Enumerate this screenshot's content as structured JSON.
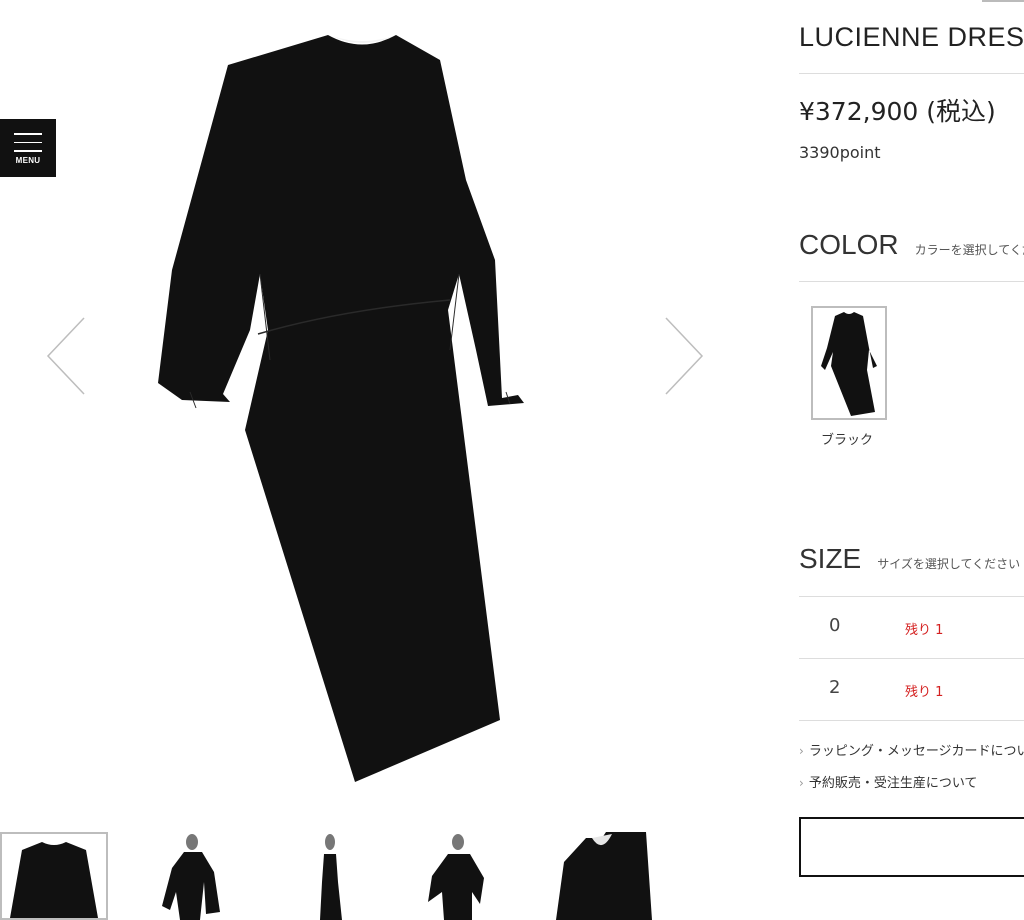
{
  "menu": {
    "label": "MENU",
    "icon": "hamburger-icon"
  },
  "gallery": {
    "prev_icon": "chevron-left-icon",
    "next_icon": "chevron-right-icon",
    "thumbnails_count": 5,
    "selected_thumbnail": 1
  },
  "product": {
    "name": "LUCIENNE DRESS",
    "price": "¥372,900 (税込)",
    "points": "3390point"
  },
  "color": {
    "heading": "COLOR",
    "hint": "カラーを選択してください",
    "options": [
      {
        "label": "ブラック"
      }
    ]
  },
  "size": {
    "heading": "SIZE",
    "hint": "サイズを選択してください",
    "rows": [
      {
        "size": "0",
        "stock": "残り 1"
      },
      {
        "size": "2",
        "stock": "残り 1"
      }
    ]
  },
  "links": [
    "ラッピング・メッセージカードについて",
    "予約販売・受注生産について"
  ],
  "colors": {
    "text": "#222222",
    "stock": "#d42020",
    "divider": "#dddddd",
    "menu_bg": "#111111"
  }
}
